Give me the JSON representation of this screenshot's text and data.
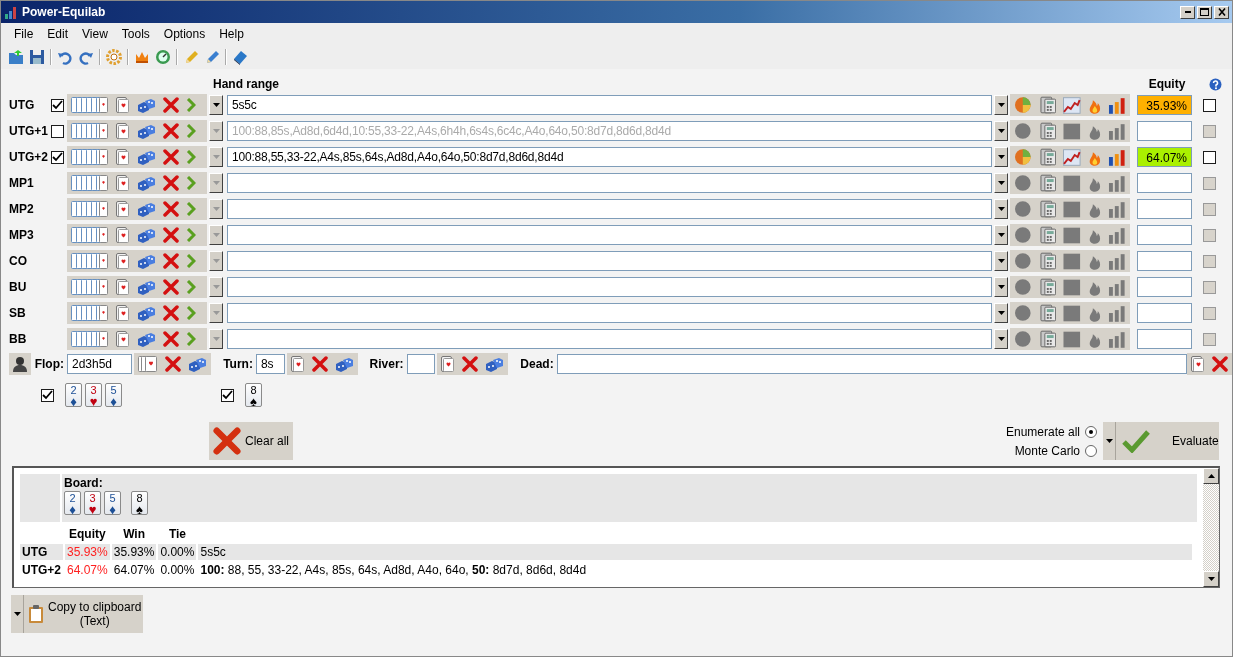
{
  "window": {
    "title": "Power-Equilab"
  },
  "menu": [
    "File",
    "Edit",
    "View",
    "Tools",
    "Options",
    "Help"
  ],
  "headers": {
    "hand_range": "Hand range",
    "equity": "Equity"
  },
  "players": [
    {
      "name": "UTG",
      "checked": true,
      "range": "5s5c",
      "equity": "35.93%",
      "color": "#ffb000",
      "lock_disabled": false
    },
    {
      "name": "UTG+1",
      "checked": false,
      "range": "100:88,85s,Ad8d,6d4d,10:55,33-22,A4s,6h4h,6s4s,6c4c,A4o,64o,50:8d7d,8d6d,8d4d",
      "lock_disabled": true
    },
    {
      "name": "UTG+2",
      "checked": true,
      "range": "100:88,55,33-22,A4s,85s,64s,Ad8d,A4o,64o,50:8d7d,8d6d,8d4d",
      "equity": "64.07%",
      "color": "#aaf000",
      "lock_disabled": false
    },
    {
      "name": "MP1",
      "lock_disabled": true
    },
    {
      "name": "MP2",
      "lock_disabled": true
    },
    {
      "name": "MP3",
      "lock_disabled": true
    },
    {
      "name": "CO",
      "lock_disabled": true
    },
    {
      "name": "BU",
      "lock_disabled": true
    },
    {
      "name": "SB",
      "lock_disabled": true
    },
    {
      "name": "BB",
      "lock_disabled": true
    }
  ],
  "board": {
    "streets": [
      {
        "kind": "flop",
        "label": "Flop:",
        "value": "2d3h5d",
        "checked": true,
        "cards": [
          {
            "rank": "2",
            "suit": "♦",
            "color": "#1c4f96"
          },
          {
            "rank": "3",
            "suit": "♥",
            "color": "#c00010"
          },
          {
            "rank": "5",
            "suit": "♦",
            "color": "#1c4f96"
          }
        ]
      },
      {
        "kind": "turn",
        "label": "Turn:",
        "value": "8s",
        "checked": true,
        "cards": [
          {
            "rank": "8",
            "suit": "♠",
            "color": "#000000"
          }
        ]
      },
      {
        "kind": "river",
        "label": "River:"
      }
    ],
    "dead": {
      "label": "Dead:"
    }
  },
  "clear_all": "Clear all",
  "modes": [
    {
      "label": "Enumerate all",
      "selected": true
    },
    {
      "label": "Monte Carlo",
      "selected": false
    }
  ],
  "evaluate": "Evaluate",
  "results": {
    "board_label": "Board:",
    "board_groups": [
      [
        {
          "rank": "2",
          "suit": "♦",
          "color": "#1c4f96"
        },
        {
          "rank": "3",
          "suit": "♥",
          "color": "#c00010"
        },
        {
          "rank": "5",
          "suit": "♦",
          "color": "#1c4f96"
        }
      ],
      [
        {
          "rank": "8",
          "suit": "♠",
          "color": "#000000"
        }
      ]
    ],
    "columns": [
      "Equity",
      "Win",
      "Tie"
    ],
    "rows": [
      {
        "name": "UTG",
        "equity": "35.93%",
        "win": "35.93%",
        "tie": "0.00%",
        "hands": "5s5c"
      },
      {
        "name": "UTG+2",
        "equity": "64.07%",
        "win": "64.07%",
        "tie": "0.00%",
        "hands": "**100:** 88, 55, 33-22, A4s, 85s, 64s, Ad8d, A4o, 64o, **50:** 8d7d, 8d6d, 8d4d"
      }
    ]
  },
  "copy_button": [
    "Copy to clipboard",
    "(Text)"
  ]
}
